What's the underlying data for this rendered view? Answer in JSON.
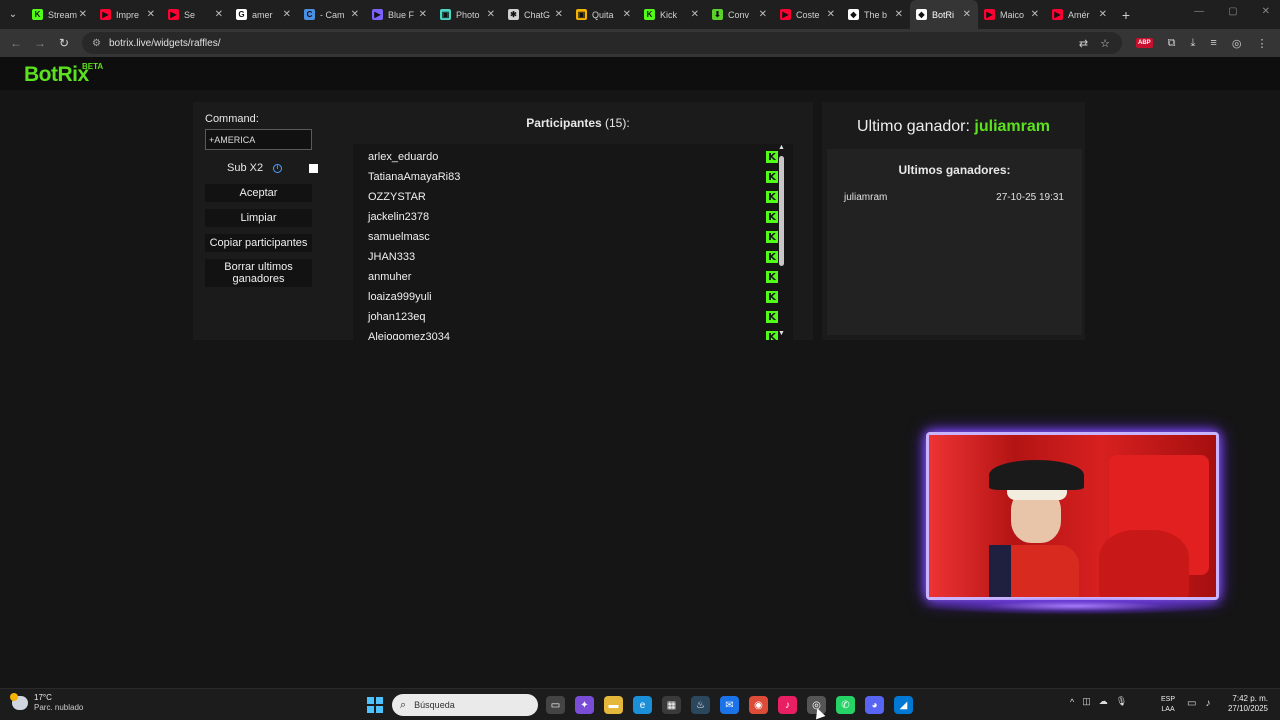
{
  "browser": {
    "tabs": [
      {
        "title": "Stream",
        "color": "#53fc18",
        "glyph": "K"
      },
      {
        "title": "Impre",
        "color": "#ff0033",
        "glyph": "▶"
      },
      {
        "title": "Se",
        "color": "#ff0033",
        "glyph": "▶"
      },
      {
        "title": "amer",
        "color": "#ffffff",
        "glyph": "G"
      },
      {
        "title": "- Cam",
        "color": "#4a90e2",
        "glyph": "C"
      },
      {
        "title": "Blue F",
        "color": "#7b61ff",
        "glyph": "▶"
      },
      {
        "title": "Photo",
        "color": "#4ad6c4",
        "glyph": "▣"
      },
      {
        "title": "ChatG",
        "color": "#d0d0d0",
        "glyph": "✱"
      },
      {
        "title": "Quita",
        "color": "#f4b400",
        "glyph": "▣"
      },
      {
        "title": "Kick",
        "color": "#53fc18",
        "glyph": "K"
      },
      {
        "title": "Conv",
        "color": "#5bd12b",
        "glyph": "⬇"
      },
      {
        "title": "Coste",
        "color": "#ff0033",
        "glyph": "▶"
      },
      {
        "title": "The b",
        "color": "#ffffff",
        "glyph": "◆"
      },
      {
        "title": "BotRi",
        "color": "#ffffff",
        "glyph": "◆"
      },
      {
        "title": "Maico",
        "color": "#ff0033",
        "glyph": "▶"
      },
      {
        "title": "Amér",
        "color": "#ff0033",
        "glyph": "▶"
      }
    ],
    "active_tab_index": 13,
    "url": "botrix.live/widgets/raffles/"
  },
  "site": {
    "logo": "BotRix",
    "beta": "BETA"
  },
  "raffle": {
    "command_label": "Command:",
    "command_value": "+AMERICA",
    "sub_label": "Sub X2",
    "sub_info": "i",
    "sub_checked": false,
    "buttons": {
      "accept": "Aceptar",
      "clear": "Limpiar",
      "copy": "Copiar participantes",
      "delete_winners": "Borrar ultimos ganadores"
    },
    "participants_label": "Participantes",
    "participants_count": "(15)",
    "participants_suffix": ":",
    "participants": [
      "arlex_eduardo",
      "TatianaAmayaRi83",
      "OZZYSTAR",
      "jackelin2378",
      "samuelmasc",
      "JHAN333",
      "anmuher",
      "loaiza999yuli",
      "johan123eq",
      "Alejogomez3034"
    ],
    "platform_glyph": "K"
  },
  "winners": {
    "last_winner_label": "Ultimo ganador:",
    "last_winner_name": "juliamram",
    "recent_title": "Ultimos ganadores:",
    "recent": [
      {
        "name": "juliamram",
        "date": "27-10-25 19:31"
      }
    ]
  },
  "taskbar": {
    "temp": "17°C",
    "condition": "Parc. nublado",
    "search_placeholder": "Búsqueda",
    "lang_top": "ESP",
    "lang_bottom": "LAA",
    "time": "7:42 p. m.",
    "date": "27/10/2025"
  }
}
